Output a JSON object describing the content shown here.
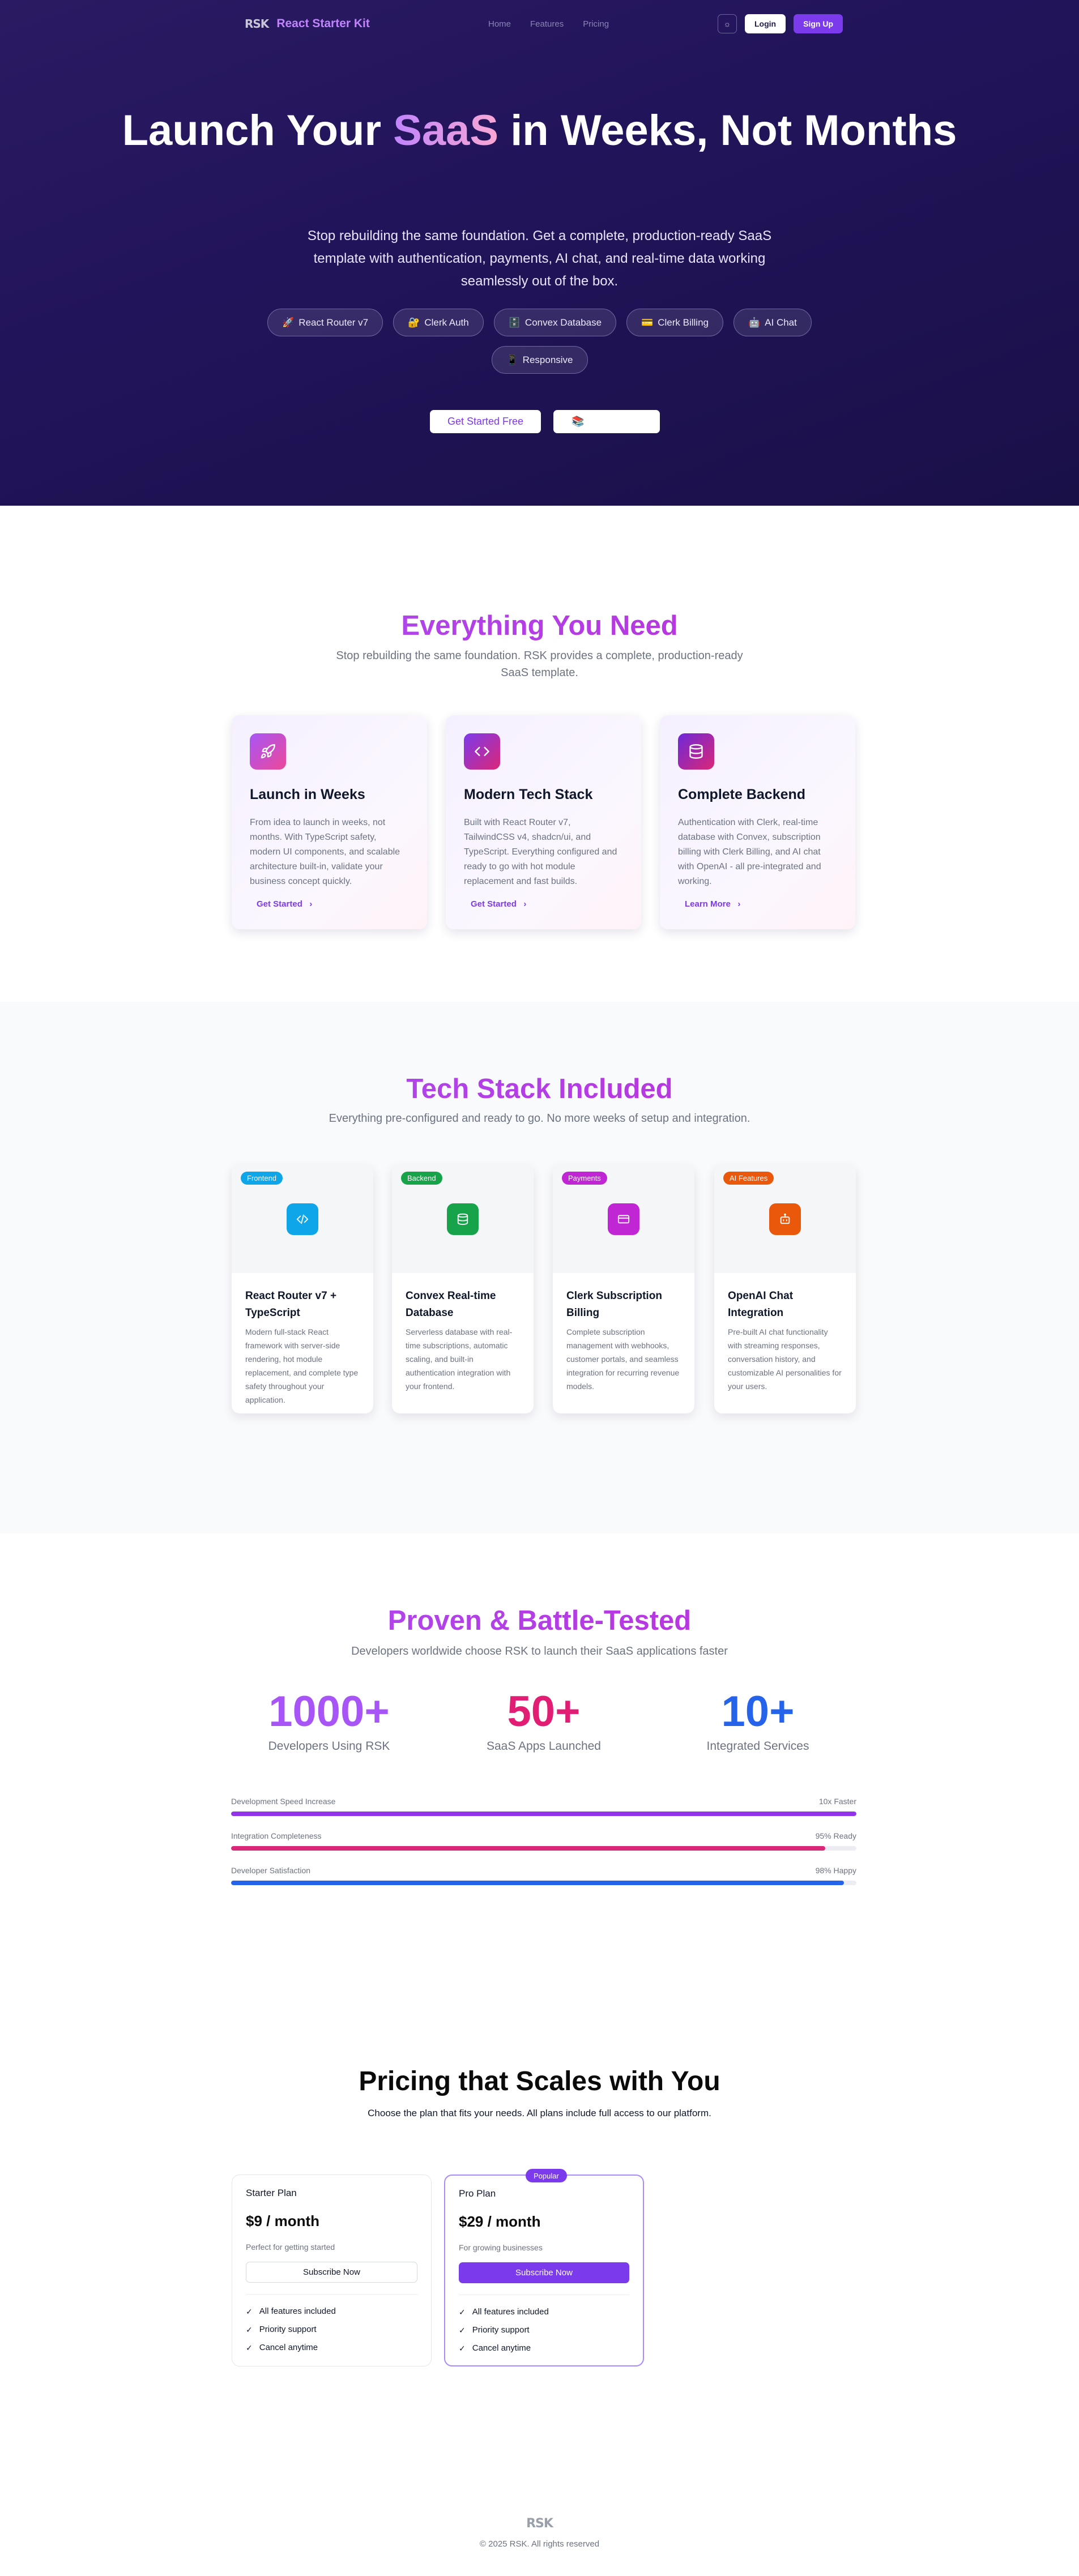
{
  "nav": {
    "logo_mark": "RSK",
    "brand": "React Starter Kit",
    "links": [
      "Home",
      "Features",
      "Pricing"
    ],
    "theme_icon": "sun-icon",
    "login": "Login",
    "signup": "Sign Up"
  },
  "hero": {
    "title_before": "Launch Your ",
    "title_accent": "SaaS",
    "title_after": " in Weeks, Not Months",
    "subtitle": "Stop rebuilding the same foundation. Get a complete, production-ready SaaS template with authentication, payments, AI chat, and real-time data working seamlessly out of the box.",
    "chips": [
      {
        "emoji": "🚀",
        "label": "React Router v7"
      },
      {
        "emoji": "🔐",
        "label": "Clerk Auth"
      },
      {
        "emoji": "🗄️",
        "label": "Convex Database"
      },
      {
        "emoji": "💳",
        "label": "Clerk Billing"
      },
      {
        "emoji": "🤖",
        "label": "AI Chat"
      },
      {
        "emoji": "📱",
        "label": "Responsive"
      }
    ],
    "cta_primary": "Get Started Free",
    "cta_secondary_emoji": "📚"
  },
  "features": {
    "title": "Everything You Need",
    "subtitle": "Stop rebuilding the same foundation. RSK provides a complete, production-ready SaaS template.",
    "cards": [
      {
        "icon": "rocket-icon",
        "name": "Launch in Weeks",
        "desc": "From idea to launch in weeks, not months. With TypeScript safety, modern UI components, and scalable architecture built-in, validate your business concept quickly.",
        "link": "Get Started"
      },
      {
        "icon": "code-icon",
        "name": "Modern Tech Stack",
        "desc": "Built with React Router v7, TailwindCSS v4, shadcn/ui, and TypeScript. Everything configured and ready to go with hot module replacement and fast builds.",
        "link": "Get Started"
      },
      {
        "icon": "database-icon",
        "name": "Complete Backend",
        "desc": "Authentication with Clerk, real-time database with Convex, subscription billing with Clerk Billing, and AI chat with OpenAI - all pre-integrated and working.",
        "link": "Learn More"
      }
    ]
  },
  "tech": {
    "title": "Tech Stack Included",
    "subtitle": "Everything pre-configured and ready to go. No more weeks of setup and integration.",
    "cards": [
      {
        "badge": "Frontend",
        "icon": "code-icon",
        "name": "React Router v7 + TypeScript",
        "desc": "Modern full-stack React framework with server-side rendering, hot module replacement, and complete type safety throughout your application.",
        "color": "#0ea5e9"
      },
      {
        "badge": "Backend",
        "icon": "database-icon",
        "name": "Convex Real-time Database",
        "desc": "Serverless database with real-time subscriptions, automatic scaling, and built-in authentication integration with your frontend.",
        "color": "#16a34a"
      },
      {
        "badge": "Payments",
        "icon": "credit-card-icon",
        "name": "Clerk Subscription Billing",
        "desc": "Complete subscription management with webhooks, customer portals, and seamless integration for recurring revenue models.",
        "color": "#c026d3"
      },
      {
        "badge": "AI Features",
        "icon": "bot-icon",
        "name": "OpenAI Chat Integration",
        "desc": "Pre-built AI chat functionality with streaming responses, conversation history, and customizable AI personalities for your users.",
        "color": "#ea580c"
      }
    ]
  },
  "proven": {
    "title": "Proven & Battle-Tested",
    "subtitle": "Developers worldwide choose RSK to launch their SaaS applications faster",
    "stats": [
      {
        "value": "1000+",
        "label": "Developers Using RSK",
        "color": "#a855f7"
      },
      {
        "value": "50+",
        "label": "SaaS Apps Launched",
        "color": "#e11d74"
      },
      {
        "value": "10+",
        "label": "Integrated Services",
        "color": "#2563eb"
      }
    ],
    "bars": [
      {
        "label": "Development Speed Increase",
        "value_text": "10x Faster",
        "fraction": 1.0,
        "color": "#9333ea"
      },
      {
        "label": "Integration Completeness",
        "value_text": "95% Ready",
        "fraction": 0.95,
        "color": "#db2777"
      },
      {
        "label": "Developer Satisfaction",
        "value_text": "98% Happy",
        "fraction": 0.98,
        "color": "#2563eb"
      }
    ]
  },
  "pricing": {
    "title": "Pricing that Scales with You",
    "subtitle": "Choose the plan that fits your needs. All plans include full access to our platform.",
    "plans": [
      {
        "name": "Starter Plan",
        "price": "$9 / month",
        "desc": "Perfect for getting started",
        "button": "Subscribe Now",
        "popular": false,
        "features": [
          "All features included",
          "Priority support",
          "Cancel anytime"
        ]
      },
      {
        "name": "Pro Plan",
        "price": "$29 / month",
        "desc": "For growing businesses",
        "button": "Subscribe Now",
        "popular": true,
        "badge": "Popular",
        "features": [
          "All features included",
          "Priority support",
          "Cancel anytime"
        ]
      }
    ]
  },
  "footer": {
    "logo_mark": "RSK",
    "copyright": "© 2025 RSK. All rights reserved"
  }
}
